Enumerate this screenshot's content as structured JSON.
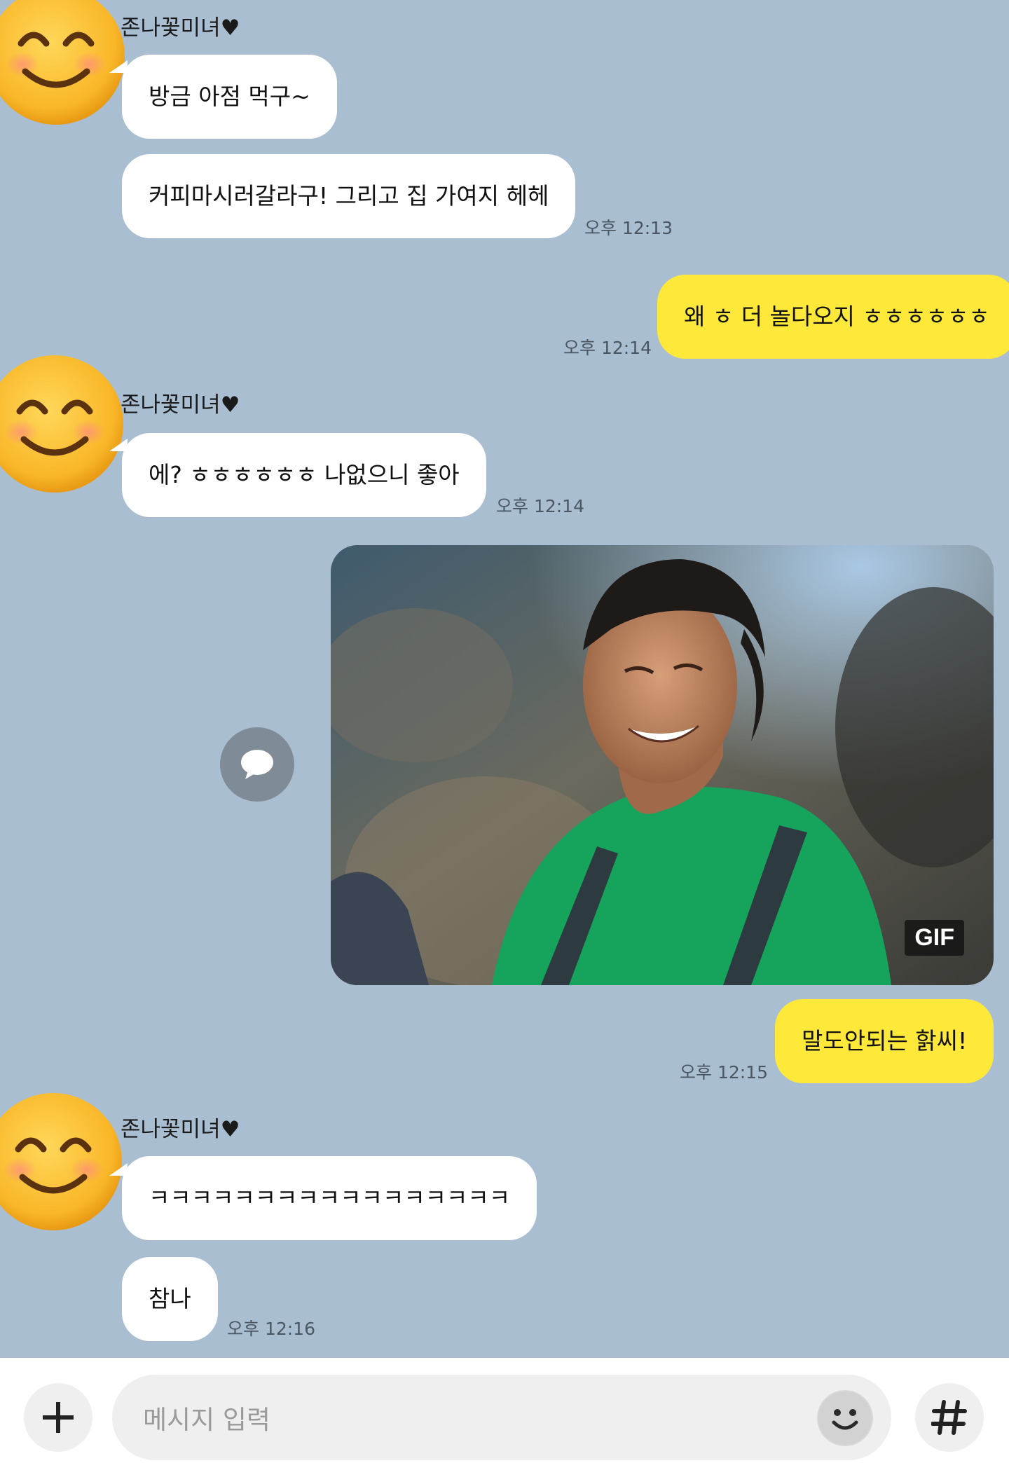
{
  "sender_name": "존나꽃미녀♥",
  "messages": {
    "m1": "방금 아점 먹구~",
    "m2": "커피마시러갈라구! 그리고 집 가여지 헤헤",
    "t2": "오후 12:13",
    "m3": "왜 ㅎ 더 놀다오지 ㅎㅎㅎㅎㅎㅎ",
    "t3": "오후 12:14",
    "m4": "에? ㅎㅎㅎㅎㅎㅎ 나없으니 좋아",
    "t4": "오후 12:14",
    "gif_label": "GIF",
    "m5": "말도안되는 핡씨!",
    "t5": "오후 12:15",
    "m6": "ㅋㅋㅋㅋㅋㅋㅋㅋㅋㅋㅋㅋㅋㅋㅋㅋㅋ",
    "m7": "참나",
    "t7": "오후 12:16"
  },
  "input": {
    "placeholder": "메시지 입력"
  },
  "icons": {
    "add": "plus-icon",
    "emoji": "emoji-icon",
    "hashtag": "hashtag-icon",
    "share": "speech-bubble-icon",
    "avatar": "smiling-face-avatar"
  },
  "colors": {
    "chat_background": "#aabed2",
    "incoming_bubble": "#ffffff",
    "outgoing_bubble": "#fee83a"
  }
}
